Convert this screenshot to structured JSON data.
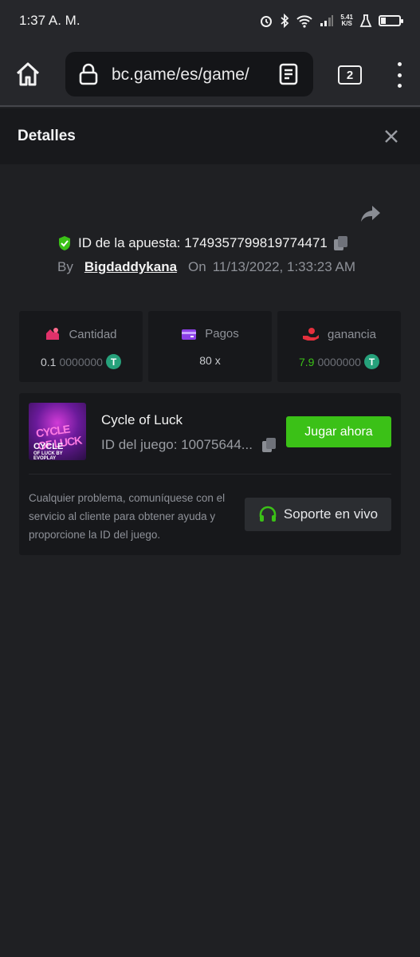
{
  "status_bar": {
    "time": "1:37 A. M.",
    "net_speed_value": "5.41",
    "net_speed_unit": "K/S"
  },
  "browser": {
    "url": "bc.game/es/game/",
    "tab_count": "2"
  },
  "dialog": {
    "title": "Detalles"
  },
  "bet": {
    "id_label": "ID de la apuesta: 1749357799819774471",
    "by_label": "By",
    "user": "Bigdaddykana",
    "on_label": "On",
    "datetime": "11/13/2022, 1:33:23 AM"
  },
  "stats": {
    "amount_label": "Cantidad",
    "amount_strong": "0.1",
    "amount_dim": "0000000",
    "payout_label": "Pagos",
    "payout_value": "80 x",
    "profit_label": "ganancia",
    "profit_strong": "7.9",
    "profit_dim": "0000000",
    "currency_symbol": "T"
  },
  "game": {
    "name": "Cycle of Luck",
    "id_text": "ID del juego: 10075644...",
    "play_label": "Jugar ahora",
    "thumb_title": "CYCLE OF LUCK",
    "thumb_caption": "CYCLE",
    "thumb_sub": "OF LUCK BY EVOPLAY"
  },
  "support": {
    "text": "Cualquier problema, comuníquese con el servicio al cliente para obtener ayuda y proporcione la ID del juego.",
    "button_label": "Soporte en vivo"
  },
  "colors": {
    "accent_green": "#3bc117",
    "usdt_green": "#26a17b"
  }
}
